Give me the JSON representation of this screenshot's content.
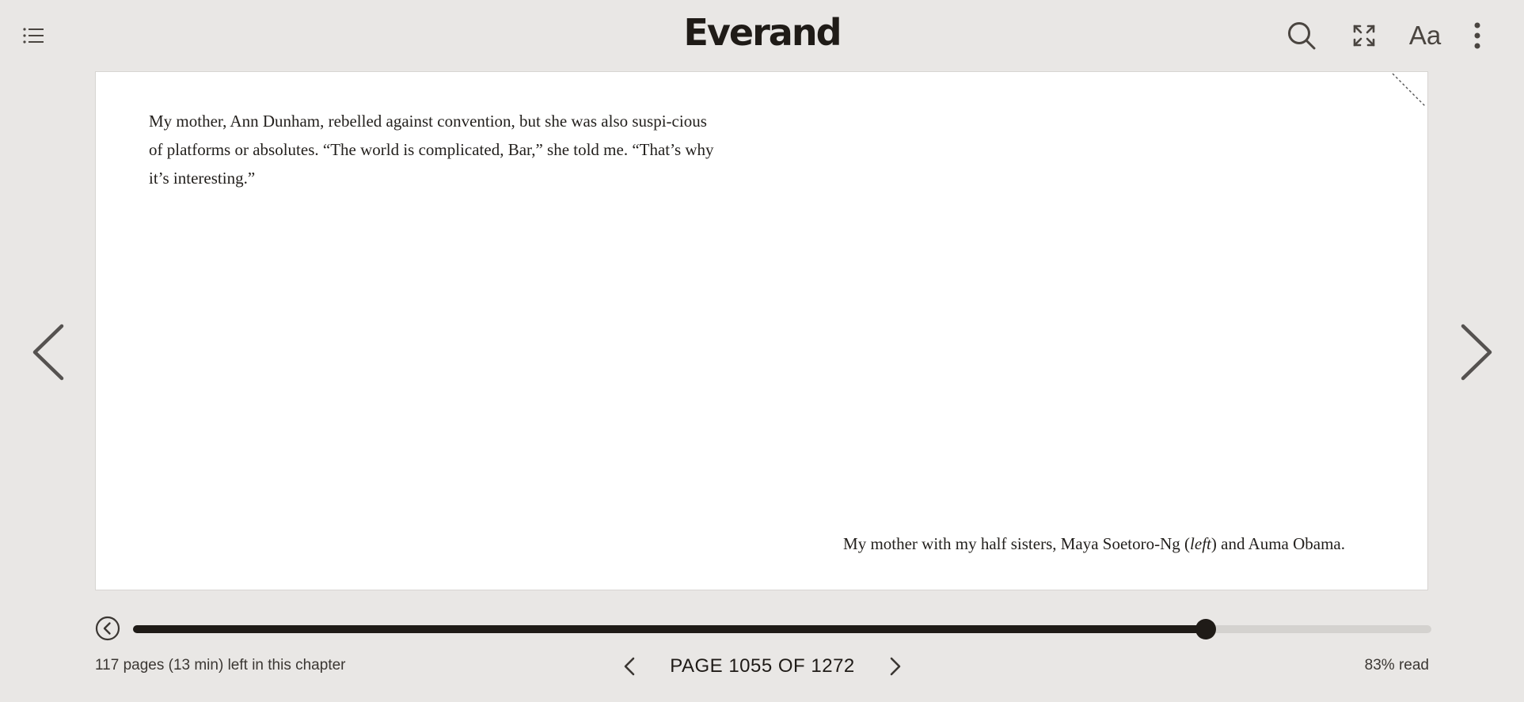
{
  "app": {
    "brand": "Everand"
  },
  "icons": {
    "toc": "table-of-contents-icon",
    "search": "search-icon",
    "expand": "expand-icon",
    "font_settings": "font-settings-icon",
    "more": "more-vertical-icon",
    "prev_page": "chevron-left-icon",
    "next_page": "chevron-right-icon",
    "back": "back-circle-icon"
  },
  "toolbar": {
    "font_label": "Aa"
  },
  "page": {
    "paragraph": "My mother, Ann Dunham, rebelled against convention, but she was also suspi-cious of platforms or absolutes. “The world is complicated, Bar,” she told me. “That’s why it’s interesting.”",
    "caption_before": "My mother with my half sisters, Maya Soetoro-Ng (",
    "caption_italic": "left",
    "caption_after": ") and Auma Obama."
  },
  "progress": {
    "fraction": 0.826
  },
  "footer": {
    "chapter_remaining": "117 pages (13 min) left in this chapter",
    "page_indicator": "PAGE 1055 OF 1272",
    "percent_read": "83% read"
  },
  "colors": {
    "background": "#e9e7e5",
    "page": "#ffffff",
    "accent": "#1f1b17"
  }
}
